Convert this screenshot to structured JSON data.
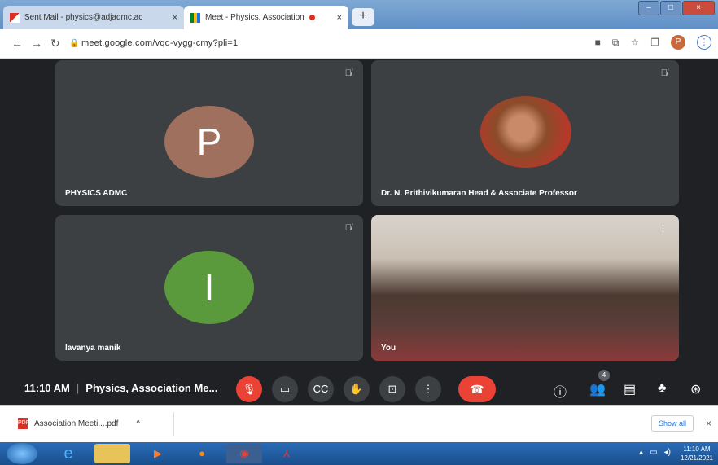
{
  "browser": {
    "tabs": [
      {
        "label": "Sent Mail - physics@adjadmc.ac",
        "close": "×"
      },
      {
        "label": "Meet - Physics, Association",
        "close": "×"
      }
    ],
    "new_tab": "+",
    "window_buttons": {
      "minimize": "–",
      "maximize": "□",
      "close": "×"
    },
    "url": "meet.google.com/vqd-vygg-cmy?pli=1",
    "profile_initial": "P"
  },
  "meet": {
    "tiles": [
      {
        "initial": "P",
        "name": "PHYSICS ADMC",
        "avatar_color": "#a0705f"
      },
      {
        "name": "Dr. N. Prithivikumaran Head & Associate Professor"
      },
      {
        "initial": "I",
        "name": "lavanya manik",
        "avatar_color": "#5b9a3c"
      },
      {
        "name": "You"
      }
    ],
    "time": "11:10 AM",
    "separator": "|",
    "meeting_title": "Physics, Association Me...",
    "participants_count": "4"
  },
  "downloads": {
    "file": "Association Meeti....pdf",
    "expand": "^",
    "show_all": "Show all",
    "close": "×"
  },
  "taskbar": {
    "time": "11:10 AM",
    "date": "12/21/2021"
  },
  "colors": {
    "accent": "#1a73e8",
    "danger": "#ea4335",
    "meet_bg": "#202124",
    "tile_bg": "#3c4043"
  }
}
